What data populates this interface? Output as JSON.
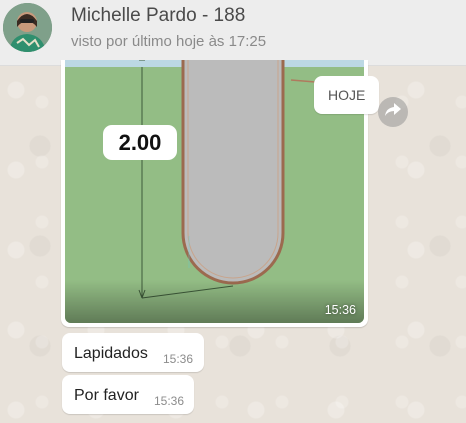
{
  "header": {
    "contact_name": "Michelle Pardo - 188",
    "last_seen": "visto por último hoje às 17:25"
  },
  "date_chip": "HOJE",
  "media": {
    "measurement_label": "2.00",
    "time": "15:36"
  },
  "messages": [
    {
      "text": "Lapidados",
      "time": "15:36"
    },
    {
      "text": "Por favor",
      "time": "15:36"
    }
  ],
  "icons": {
    "forward": "forward-arrow-icon",
    "avatar": "contact-avatar"
  },
  "colors": {
    "header_bg": "#ededed",
    "chat_bg": "#e8e2da",
    "bubble_bg": "#ffffff",
    "image_green": "#93bd85"
  }
}
